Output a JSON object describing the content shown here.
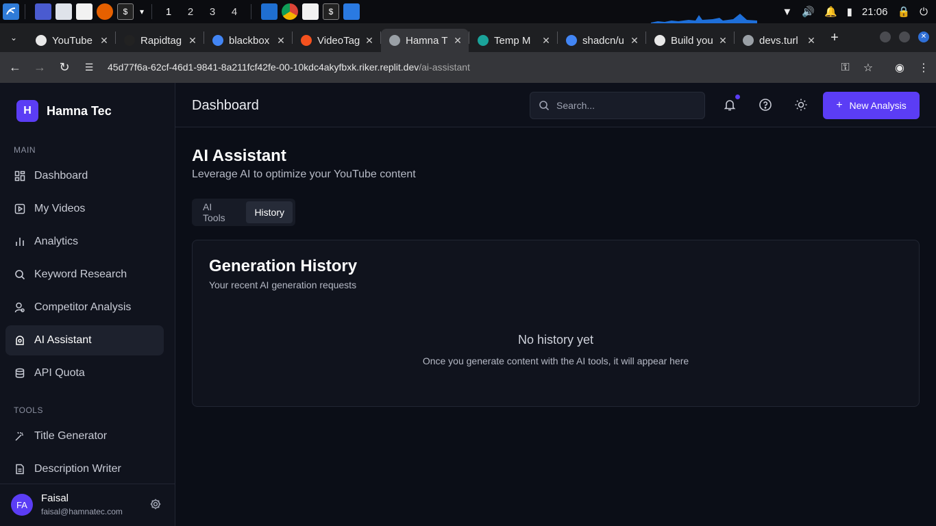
{
  "taskbar": {
    "workspaces": [
      "1",
      "2",
      "3",
      "4"
    ],
    "clock": "21:06"
  },
  "browser": {
    "tabs": [
      {
        "title": "YouTube",
        "favicon_color": "#e8e8e8"
      },
      {
        "title": "Rapidtag",
        "favicon_color": "#222222"
      },
      {
        "title": "blackbox",
        "favicon_color": "#4285f4"
      },
      {
        "title": "VideoTag",
        "favicon_color": "#f4511e"
      },
      {
        "title": "Hamna T",
        "favicon_color": "#9aa0a6"
      },
      {
        "title": "Temp M",
        "favicon_color": "#1aa39a"
      },
      {
        "title": "shadcn/u",
        "favicon_color": "#4285f4"
      },
      {
        "title": "Build you",
        "favicon_color": "#e8e8e8"
      },
      {
        "title": "devs.turl",
        "favicon_color": "#9aa0a6"
      }
    ],
    "url_host": "45d77f6a-62cf-46d1-9841-8a211fcf42fe-00-10kdc4akyfbxk.riker.replit.dev",
    "url_path": "/ai-assistant"
  },
  "brand": {
    "initial": "H",
    "name": "Hamna Tec"
  },
  "sidebar": {
    "main_label": "MAIN",
    "tools_label": "TOOLS",
    "items": [
      {
        "label": "Dashboard"
      },
      {
        "label": "My Videos"
      },
      {
        "label": "Analytics"
      },
      {
        "label": "Keyword Research"
      },
      {
        "label": "Competitor Analysis"
      },
      {
        "label": "AI Assistant"
      },
      {
        "label": "API Quota"
      }
    ],
    "tools": [
      {
        "label": "Title Generator"
      },
      {
        "label": "Description Writer"
      }
    ]
  },
  "user": {
    "initials": "FA",
    "name": "Faisal",
    "email": "faisal@hamnatec.com"
  },
  "header": {
    "title": "Dashboard",
    "search_placeholder": "Search...",
    "new_button": "New Analysis"
  },
  "main": {
    "title": "AI Assistant",
    "subtitle": "Leverage AI to optimize your YouTube content",
    "tabs": [
      {
        "label": "AI Tools"
      },
      {
        "label": "History"
      }
    ],
    "card": {
      "title": "Generation History",
      "subtitle": "Your recent AI generation requests",
      "empty_title": "No history yet",
      "empty_subtitle": "Once you generate content with the AI tools, it will appear here"
    }
  },
  "colors": {
    "accent": "#5b3df5",
    "background": "#0b0e17",
    "sidebar": "#10131d"
  }
}
